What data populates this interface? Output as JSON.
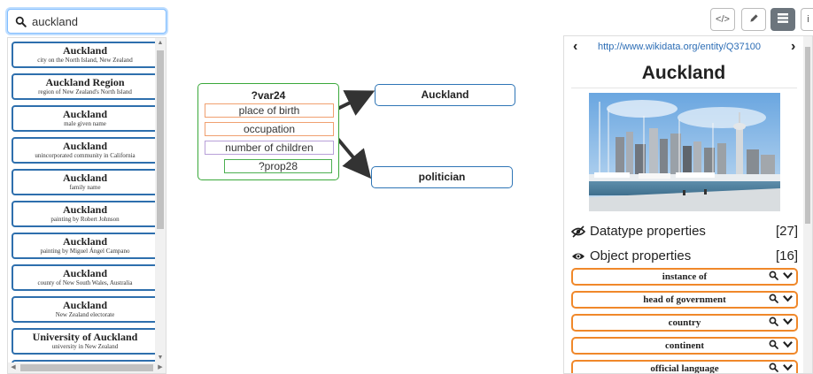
{
  "search": {
    "value": "auckland",
    "placeholder": ""
  },
  "results": [
    {
      "title": "Auckland",
      "desc": "city on the North Island, New Zealand"
    },
    {
      "title": "Auckland Region",
      "desc": "region of New Zealand's North Island"
    },
    {
      "title": "Auckland",
      "desc": "male given name"
    },
    {
      "title": "Auckland",
      "desc": "unincorporated community in California"
    },
    {
      "title": "Auckland",
      "desc": "family name"
    },
    {
      "title": "Auckland",
      "desc": "painting by Robert Johnson"
    },
    {
      "title": "Auckland",
      "desc": "painting by Miguel Ángel Campano"
    },
    {
      "title": "Auckland",
      "desc": "county of New South Wales, Australia"
    },
    {
      "title": "Auckland",
      "desc": "New Zealand electorate"
    },
    {
      "title": "University of Auckland",
      "desc": "university in New Zealand"
    }
  ],
  "graph": {
    "variable": "?var24",
    "properties": [
      "place of birth",
      "occupation",
      "number of children"
    ],
    "sub_property": "?prop28",
    "targets": [
      "Auckland",
      "politician"
    ]
  },
  "toolbar": {
    "code_label": "</>",
    "info_label": "i"
  },
  "panel": {
    "uri": "http://www.wikidata.org/entity/Q37100",
    "title": "Auckland",
    "datatype_label": "Datatype properties",
    "datatype_count": "[27]",
    "object_label": "Object properties",
    "object_count": "[16]",
    "object_properties": [
      "instance of",
      "head of government",
      "country",
      "continent",
      "official language"
    ]
  },
  "colors": {
    "accent_blue": "#2e75b6",
    "var_green": "#3aa83a",
    "prop_orange": "#f0882a",
    "link": "#2c6db5"
  },
  "icons": [
    "search-icon",
    "code-icon",
    "pencil-icon",
    "list-icon",
    "info-icon",
    "chevron-left-icon",
    "chevron-right-icon",
    "eye-slash-icon",
    "eye-icon",
    "chevron-down-icon"
  ]
}
